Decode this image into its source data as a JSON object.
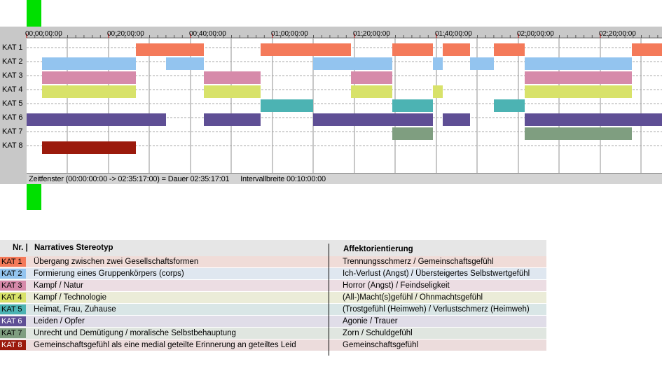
{
  "timeline": {
    "time_labels": [
      "00:00:00:00",
      "00:20:00:00",
      "00:40:00:00",
      "01:00:00:00",
      "01:20:00:00",
      "01:40:00:00",
      "02:00:00:00",
      "02:20:00:00"
    ],
    "rows": [
      "KAT 1",
      "KAT 2",
      "KAT 3",
      "KAT 4",
      "KAT 5",
      "KAT 6",
      "KAT 7",
      "KAT 8"
    ],
    "status": {
      "window": "Zeitfenster (00:00:00:00 -> 02:35:17:00) = Dauer 02:35:17:01",
      "interval": "Intervallbreite 00:10:00:00"
    }
  },
  "legend": {
    "header": {
      "nr": "Nr. |",
      "stereotype": "Narratives Stereotyp",
      "affect": "Affektorientierung"
    },
    "rows": [
      {
        "badge": "KAT 1",
        "badge_color": "#f47a5a",
        "bg": "#f0dcd8",
        "text": "Übergang zwischen zwei Gesellschaftsformen",
        "affect": "Trennungsschmerz / Gemeinschaftsgefühl"
      },
      {
        "badge": "KAT 2",
        "badge_color": "#93c4ef",
        "bg": "#dfe7f0",
        "text": "Formierung eines Gruppenkörpers (corps)",
        "affect": "Ich-Verlust (Angst) / Übersteigertes Selbstwertgefühl"
      },
      {
        "badge": "KAT 3",
        "badge_color": "#d68aaa",
        "bg": "#ecdde3",
        "text": "Kampf / Natur",
        "affect": "Horror (Angst) / Feindseligkeit"
      },
      {
        "badge": "KAT 4",
        "badge_color": "#d8e26a",
        "bg": "#ebecd8",
        "text": "Kampf / Technologie",
        "affect": "(All-)Macht(s)gefühl / Ohnmachtsgefühl"
      },
      {
        "badge": "KAT 5",
        "badge_color": "#4cb3b3",
        "bg": "#d9e6e6",
        "text": "Heimat, Frau, Zuhause",
        "affect": "(Trostgefühl (Heimweh) / Verlustschmerz (Heimweh)"
      },
      {
        "badge": "KAT 6",
        "badge_color": "#5f4f95",
        "bg": "#e0dde8",
        "text": "Leiden / Opfer",
        "affect": "Agonie / Trauer"
      },
      {
        "badge": "KAT 7",
        "badge_color": "#7f9e80",
        "bg": "#e0e6e0",
        "text": "Unrecht und Demütigung / moralische Selbstbehauptung",
        "affect": "Zorn / Schuldgefühl"
      },
      {
        "badge": "KAT 8",
        "badge_color": "#9b1a0c",
        "bg": "#ecdcdc",
        "text": "Gemeinschaftsgefühl als eine medial geteilte Erinnerung an geteiltes Leid",
        "affect": "Gemeinschaftsgefühl"
      }
    ]
  },
  "colors": {
    "kat1": "#f47a5a",
    "kat2": "#93c4ef",
    "kat3": "#d68aaa",
    "kat4": "#d8e26a",
    "kat5": "#4cb3b3",
    "kat6": "#5f4f95",
    "kat7": "#7f9e80",
    "kat8": "#9b1a0c"
  }
}
